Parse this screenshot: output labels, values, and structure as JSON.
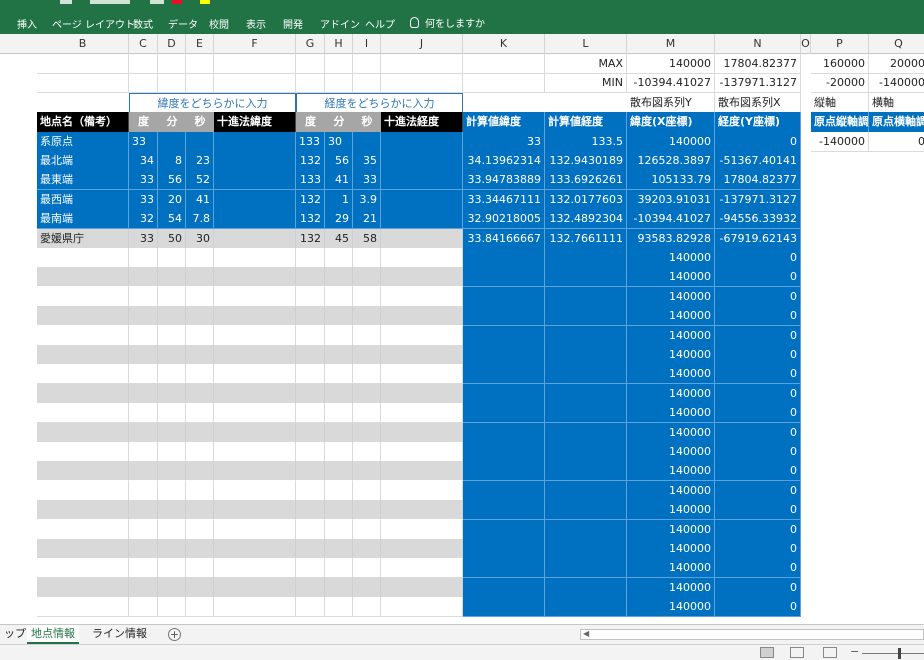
{
  "ribbon": {
    "tabs": [
      "挿入",
      "ページ レイアウト",
      "数式",
      "データ",
      "校閲",
      "表示",
      "開発",
      "アドイン",
      "ヘルプ"
    ],
    "tell_me": "何をしますか"
  },
  "columns": [
    "B",
    "C",
    "D",
    "E",
    "F",
    "G",
    "H",
    "I",
    "J",
    "K",
    "L",
    "M",
    "N",
    "O",
    "P",
    "Q"
  ],
  "summary": {
    "max_label": "MAX",
    "min_label": "MIN",
    "max_values": [
      "140000",
      "17804.82377",
      "160000",
      "20000"
    ],
    "min_values": [
      "-10394.41027",
      "-137971.3127",
      "-20000",
      "-140000"
    ]
  },
  "input_notes": {
    "lat": "緯度をどちらかに入力",
    "lon": "経度をどちらかに入力"
  },
  "series_labels": {
    "y": "散布図系列Y",
    "x": "散布図系列X",
    "vaxis": "縦軸",
    "haxis": "横軸"
  },
  "headers": {
    "a": "",
    "name": "地点名（備考）",
    "deg": "度",
    "min": "分",
    "sec": "秒",
    "dec_lat": "十進法緯度",
    "deg2": "度",
    "min2": "分",
    "sec2": "秒",
    "dec_lon": "十進法経度",
    "calc_lat": "計算値緯度",
    "calc_lon": "計算値経度",
    "x_coord": "緯度(X座標)",
    "y_coord": "経度(Y座標)",
    "p": "原点縦軸調",
    "q": "原点横軸調"
  },
  "rows": [
    {
      "a": "系原点",
      "name": "系原点",
      "c": "33",
      "d": "",
      "e": "",
      "g": "133",
      "h": "30",
      "i": "",
      "k": "33",
      "l": "133.5",
      "m": "140000",
      "n": "0",
      "p": "-140000",
      "q": "0"
    },
    {
      "a": "",
      "name": "最北端",
      "c": "34",
      "d": "8",
      "e": "23",
      "g": "132",
      "h": "56",
      "i": "35",
      "k": "34.13962314",
      "l": "132.9430189",
      "m": "126528.3897",
      "n": "-51367.40141"
    },
    {
      "a": "",
      "name": "最東端",
      "c": "33",
      "d": "56",
      "e": "52",
      "g": "133",
      "h": "41",
      "i": "33",
      "k": "33.94783889",
      "l": "133.6926261",
      "m": "105133.79",
      "n": "17804.82377"
    },
    {
      "a": "",
      "name": "最西端",
      "c": "33",
      "d": "20",
      "e": "41",
      "g": "132",
      "h": "1",
      "i": "3.9",
      "k": "33.34467111",
      "l": "132.0177603",
      "m": "39203.91031",
      "n": "-137971.3127"
    },
    {
      "a": "",
      "name": "最南端",
      "c": "32",
      "d": "54",
      "e": "7.8",
      "g": "132",
      "h": "29",
      "i": "21",
      "k": "32.90218005",
      "l": "132.4892304",
      "m": "-10394.41027",
      "n": "-94556.33932"
    },
    {
      "a": "",
      "name": "愛媛県庁",
      "c": "33",
      "d": "50",
      "e": "30",
      "g": "132",
      "h": "45",
      "i": "58",
      "k": "33.84166667",
      "l": "132.7661111",
      "m": "93583.82928",
      "n": "-67919.62143"
    }
  ],
  "fill_m": "140000",
  "fill_n": "0",
  "fill_rows": 19,
  "sheets": [
    "ップ",
    "地点情報",
    "ライン情報"
  ]
}
